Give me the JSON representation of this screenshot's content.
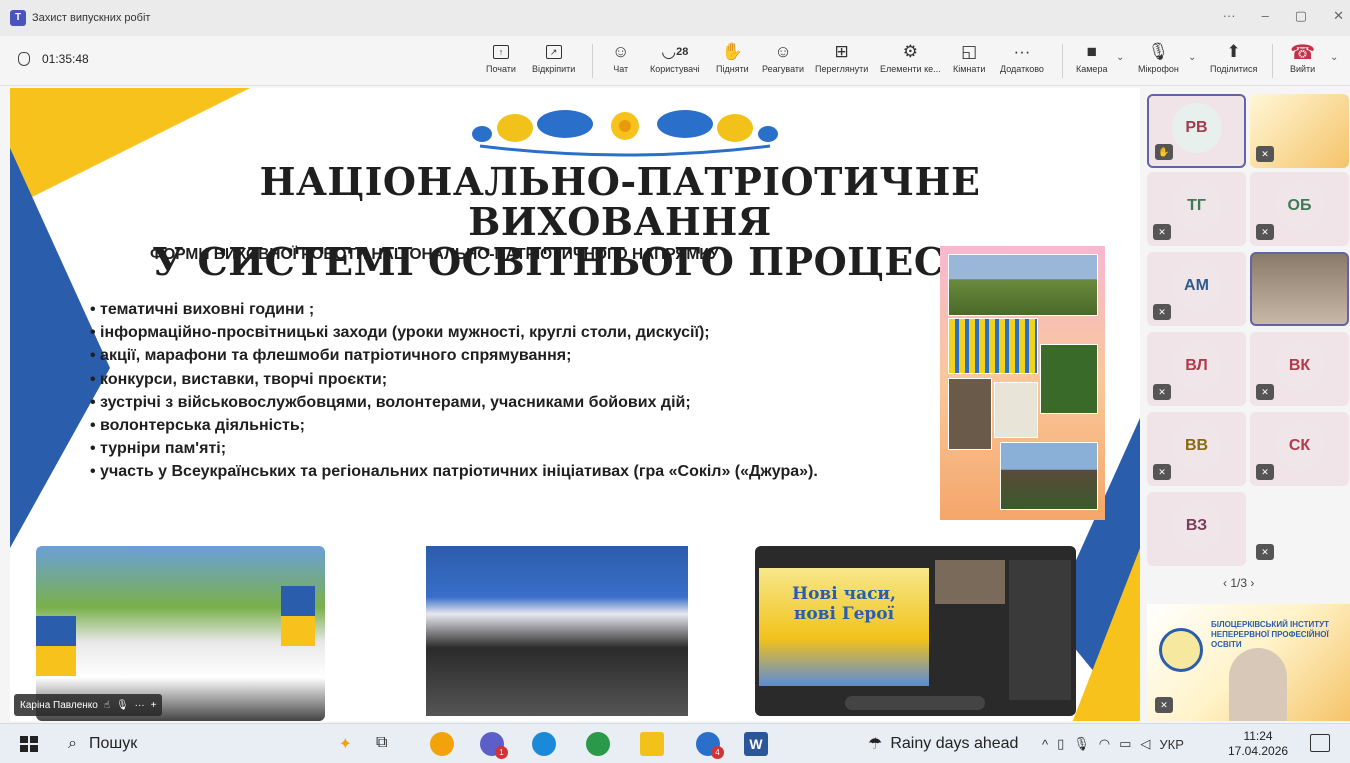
{
  "window": {
    "title": "Захист випускних робіт"
  },
  "call": {
    "timer": "01:35:48",
    "toolbar": [
      {
        "label": "Почати",
        "icon": "present-icon"
      },
      {
        "label": "Відкріпити",
        "icon": "unpin-icon"
      },
      {
        "label": "Чат",
        "icon": "chat-icon"
      },
      {
        "label": "Користувачі",
        "icon": "people-icon",
        "count": "28"
      },
      {
        "label": "Підняти",
        "icon": "raise-hand-icon"
      },
      {
        "label": "Реагувати",
        "icon": "react-icon"
      },
      {
        "label": "Переглянути",
        "icon": "view-icon"
      },
      {
        "label": "Елементи ке...",
        "icon": "controls-icon"
      },
      {
        "label": "Кімнати",
        "icon": "rooms-icon"
      },
      {
        "label": "Додатково",
        "icon": "more-icon"
      }
    ],
    "media": [
      {
        "label": "Камера",
        "icon": "camera-icon"
      },
      {
        "label": "Мікрофон",
        "icon": "mic-off-icon"
      },
      {
        "label": "Поділитися",
        "icon": "share-icon"
      },
      {
        "label": "Вийти",
        "icon": "hangup-icon"
      }
    ]
  },
  "slide": {
    "title_line1": "НАЦІОНАЛЬНО-ПАТРІОТИЧНЕ ВИХОВАННЯ",
    "title_line2": "У СИСТЕМІ ОСВІТНЬОГО ПРОЦЕСУ ЗПО",
    "subtitle": "ФОРМИ ВИХОВНОЇ РОБОТИ НАЦІОНАЛЬНО-ПАТРІОТИЧНОГО НАПРЯМКУ",
    "bullets": [
      "тематичні виховні години ;",
      "інформаційно-просвітницькі заходи (уроки мужності, круглі столи, дискусії);",
      "акції, марафони та флешмоби патріотичного спрямування;",
      "конкурси, виставки, творчі проєкти;",
      "зустрічі з військовослужбовцями, волонтерами, учасниками бойових дій;",
      "волонтерська діяльність;",
      "турніри пам'яті;",
      "участь у Всеукраїнських та регіональних патріотичних ініціативах (гра «Сокіл» («Джура»)."
    ],
    "screen_banner_line1": "Нові часи,",
    "screen_banner_line2": "нові Герої"
  },
  "participants": [
    {
      "initials": "РВ",
      "color": "#a33a4f",
      "bg": "#e8f0ee"
    },
    {
      "initials": "ТГ",
      "color": "#3d7a55",
      "bg": "#f0e6ea"
    },
    {
      "initials": "ОБ",
      "color": "#3d7a55",
      "bg": "#f0e6ea"
    },
    {
      "initials": "АМ",
      "color": "#2f5b8a",
      "bg": "#f0e6ea"
    },
    {
      "initials": "ВЛ",
      "color": "#b33a4a",
      "bg": "#f0e6ea"
    },
    {
      "initials": "ВК",
      "color": "#b33a4a",
      "bg": "#f0e6ea"
    },
    {
      "initials": "ВВ",
      "color": "#8a6a10",
      "bg": "#f0e6ea"
    },
    {
      "initials": "СК",
      "color": "#b33a4a",
      "bg": "#f0e6ea"
    },
    {
      "initials": "ВЗ",
      "color": "#7a3d5a",
      "bg": "#f0e6ea"
    }
  ],
  "pager": "1/3",
  "institute": {
    "name_line1": "БІЛОЦЕРКІВСЬКИЙ ІНСТИТУТ",
    "name_line2": "НЕПЕРЕРВНОЇ ПРОФЕСІЙНОЇ ОСВІТИ"
  },
  "nametag": "Каріна Павленко",
  "taskbar": {
    "search_placeholder": "Пошук",
    "weather": "Rainy days ahead",
    "lang": "УКР",
    "time": "11:24",
    "date": "17.04.2026"
  }
}
